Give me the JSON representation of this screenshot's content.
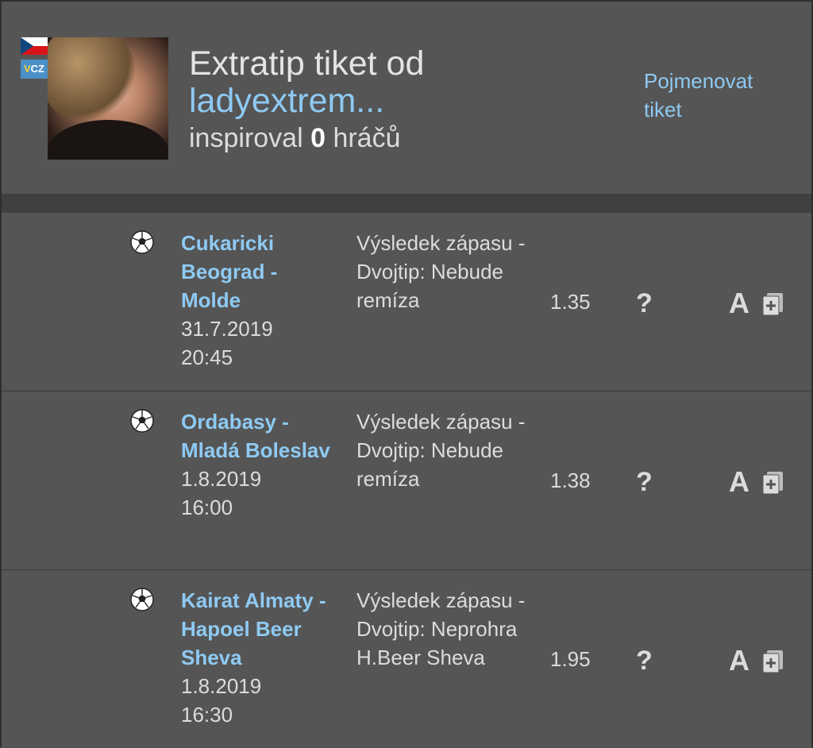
{
  "header": {
    "title_prefix": "Extratip tiket od",
    "username": "ladyextrem...",
    "inspired_prefix": "inspiroval",
    "inspired_count": "0",
    "inspired_suffix": "hráčů",
    "rename_label": "Pojmenovat tiket",
    "badge_text_v": "V",
    "badge_text_cz": "CZ"
  },
  "bets": [
    {
      "sport_icon": "soccer-ball-icon",
      "teams": "Cukaricki Beograd - Molde",
      "date": "31.7.2019",
      "time": "20:45",
      "bet_type": "Výsledek zápasu - Dvojtip: Nebude remíza",
      "odds": "1.35",
      "status": "?",
      "action_label": "A"
    },
    {
      "sport_icon": "soccer-ball-icon",
      "teams": "Ordabasy - Mladá Boleslav",
      "date": "1.8.2019",
      "time": "16:00",
      "bet_type": "Výsledek zápasu - Dvojtip: Nebude remíza",
      "odds": "1.38",
      "status": "?",
      "action_label": "A"
    },
    {
      "sport_icon": "soccer-ball-icon",
      "teams": "Kairat Almaty - Hapoel Beer Sheva",
      "date": "1.8.2019",
      "time": "16:30",
      "bet_type": "Výsledek zápasu - Dvojtip: Neprohra H.Beer Sheva",
      "odds": "1.95",
      "status": "?",
      "action_label": "A"
    }
  ],
  "colors": {
    "background": "#555555",
    "link": "#8ecaf3",
    "text": "#dcdcdc"
  }
}
